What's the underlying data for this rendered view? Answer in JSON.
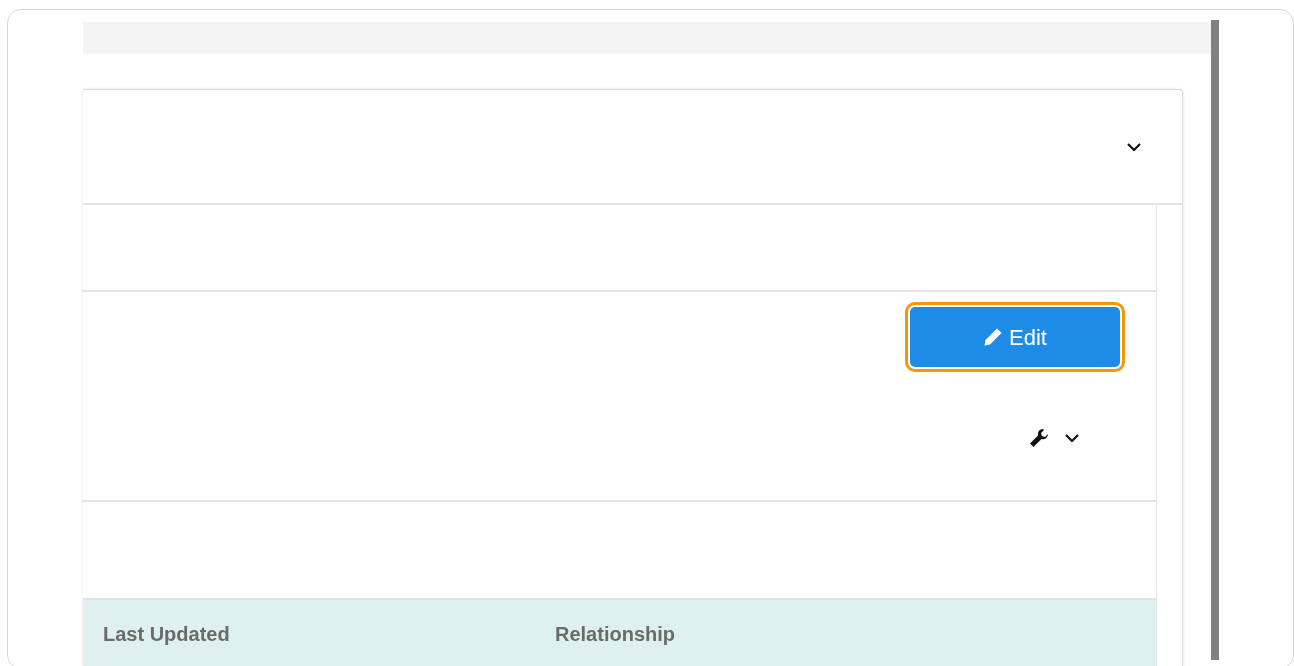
{
  "edit_button": {
    "label": "Edit"
  },
  "table": {
    "columns": [
      "Last Updated",
      "Relationship"
    ]
  }
}
